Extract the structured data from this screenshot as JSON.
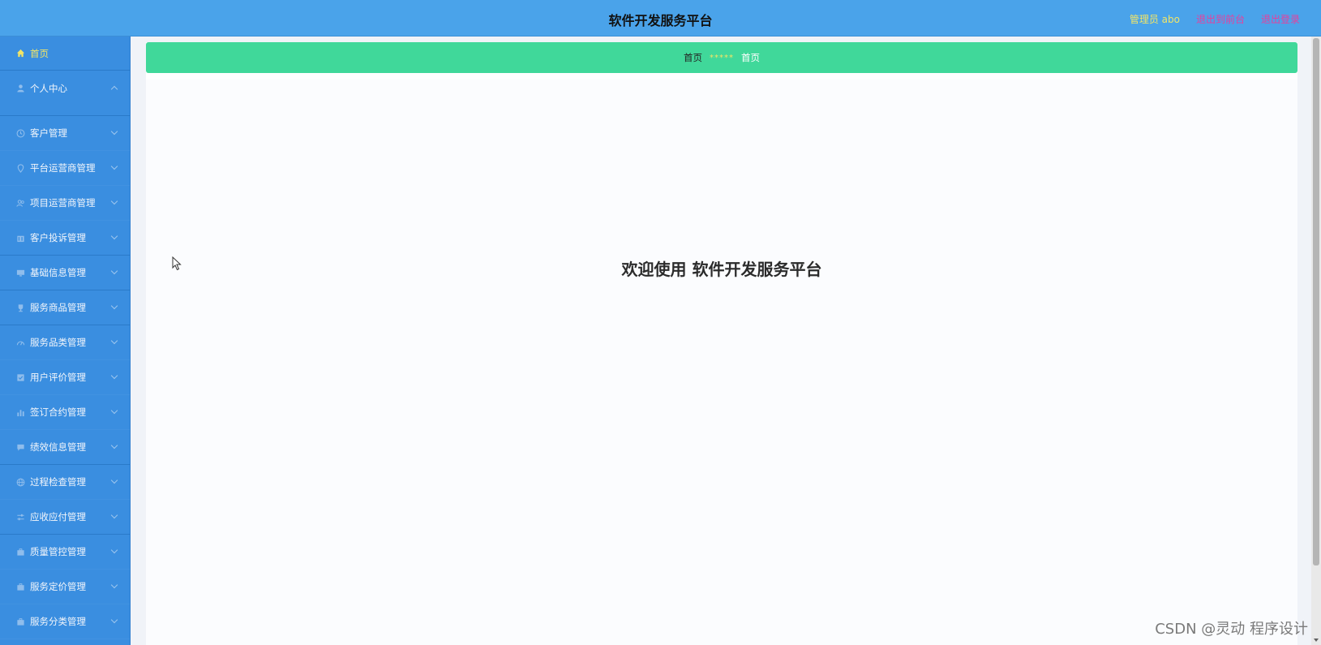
{
  "header": {
    "title": "软件开发服务平台",
    "admin_label": "管理员 abo",
    "back_front_label": "退出到前台",
    "logout_label": "退出登录"
  },
  "sidebar": {
    "items": [
      {
        "label": "首页",
        "icon": "home-icon"
      },
      {
        "label": "个人中心",
        "icon": "user-icon"
      },
      {
        "label": "客户管理",
        "icon": "clock-icon"
      },
      {
        "label": "平台运营商管理",
        "icon": "location-icon"
      },
      {
        "label": "项目运营商管理",
        "icon": "users-icon"
      },
      {
        "label": "客户投诉管理",
        "icon": "building-icon"
      },
      {
        "label": "基础信息管理",
        "icon": "monitor-icon"
      },
      {
        "label": "服务商品管理",
        "icon": "trophy-icon"
      },
      {
        "label": "服务品类管理",
        "icon": "gauge-icon"
      },
      {
        "label": "用户评价管理",
        "icon": "checkbox-icon"
      },
      {
        "label": "签订合约管理",
        "icon": "bar-chart-icon"
      },
      {
        "label": "绩效信息管理",
        "icon": "comment-icon"
      },
      {
        "label": "过程检查管理",
        "icon": "globe-icon"
      },
      {
        "label": "应收应付管理",
        "icon": "sliders-icon"
      },
      {
        "label": "质量管控管理",
        "icon": "briefcase-icon"
      },
      {
        "label": "服务定价管理",
        "icon": "briefcase-icon"
      },
      {
        "label": "服务分类管理",
        "icon": "briefcase-icon"
      }
    ]
  },
  "breadcrumb": {
    "first": "首页",
    "separator": "*****",
    "current": "首页"
  },
  "main": {
    "welcome": "欢迎使用 软件开发服务平台"
  },
  "watermark": "CSDN @灵动 程序设计",
  "colors": {
    "header_bg": "#4aa3ea",
    "sidebar_bg": "#3a8ee0",
    "breadcrumb_bg": "#40d89a",
    "accent_yellow": "#f2e566",
    "link_pink": "#e83f9c"
  }
}
